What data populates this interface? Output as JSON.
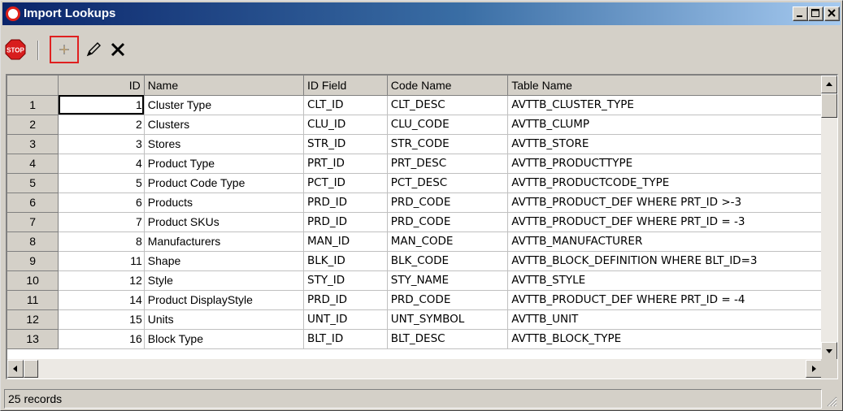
{
  "window": {
    "title": "Import Lookups",
    "controls": [
      "minimize",
      "maximize",
      "close"
    ]
  },
  "toolbar": {
    "items": [
      {
        "name": "stop",
        "label": "STOP"
      },
      {
        "name": "add"
      },
      {
        "name": "edit"
      },
      {
        "name": "delete"
      }
    ],
    "highlighted": "add",
    "highlight_color": "#e02020"
  },
  "grid": {
    "columns": [
      "",
      "ID",
      "Name",
      "ID Field",
      "Code Name",
      "Table Name"
    ],
    "rows": [
      {
        "row": "1",
        "id": "1",
        "name": "Cluster Type",
        "id_field": "CLT_ID",
        "code_name": "CLT_DESC",
        "table_name": "AVTTB_CLUSTER_TYPE"
      },
      {
        "row": "2",
        "id": "2",
        "name": "Clusters",
        "id_field": "CLU_ID",
        "code_name": "CLU_CODE",
        "table_name": "AVTTB_CLUMP"
      },
      {
        "row": "3",
        "id": "3",
        "name": "Stores",
        "id_field": "STR_ID",
        "code_name": "STR_CODE",
        "table_name": "AVTTB_STORE"
      },
      {
        "row": "4",
        "id": "4",
        "name": "Product Type",
        "id_field": "PRT_ID",
        "code_name": "PRT_DESC",
        "table_name": "AVTTB_PRODUCTTYPE"
      },
      {
        "row": "5",
        "id": "5",
        "name": "Product Code Type",
        "id_field": "PCT_ID",
        "code_name": "PCT_DESC",
        "table_name": "AVTTB_PRODUCTCODE_TYPE"
      },
      {
        "row": "6",
        "id": "6",
        "name": "Products",
        "id_field": "PRD_ID",
        "code_name": "PRD_CODE",
        "table_name": "AVTTB_PRODUCT_DEF WHERE PRT_ID >-3"
      },
      {
        "row": "7",
        "id": "7",
        "name": "Product SKUs",
        "id_field": "PRD_ID",
        "code_name": "PRD_CODE",
        "table_name": "AVTTB_PRODUCT_DEF WHERE PRT_ID = -3"
      },
      {
        "row": "8",
        "id": "8",
        "name": "Manufacturers",
        "id_field": "MAN_ID",
        "code_name": "MAN_CODE",
        "table_name": "AVTTB_MANUFACTURER"
      },
      {
        "row": "9",
        "id": "11",
        "name": "Shape",
        "id_field": "BLK_ID",
        "code_name": "BLK_CODE",
        "table_name": "AVTTB_BLOCK_DEFINITION WHERE BLT_ID=3"
      },
      {
        "row": "10",
        "id": "12",
        "name": "Style",
        "id_field": "STY_ID",
        "code_name": "STY_NAME",
        "table_name": "AVTTB_STYLE"
      },
      {
        "row": "11",
        "id": "14",
        "name": "Product DisplayStyle",
        "id_field": "PRD_ID",
        "code_name": "PRD_CODE",
        "table_name": "AVTTB_PRODUCT_DEF WHERE PRT_ID = -4"
      },
      {
        "row": "12",
        "id": "15",
        "name": "Units",
        "id_field": "UNT_ID",
        "code_name": "UNT_SYMBOL",
        "table_name": "AVTTB_UNIT"
      },
      {
        "row": "13",
        "id": "16",
        "name": "Block Type",
        "id_field": "BLT_ID",
        "code_name": "BLT_DESC",
        "table_name": "AVTTB_BLOCK_TYPE"
      }
    ],
    "selected_row": 0
  },
  "status": {
    "text": "25 records"
  }
}
